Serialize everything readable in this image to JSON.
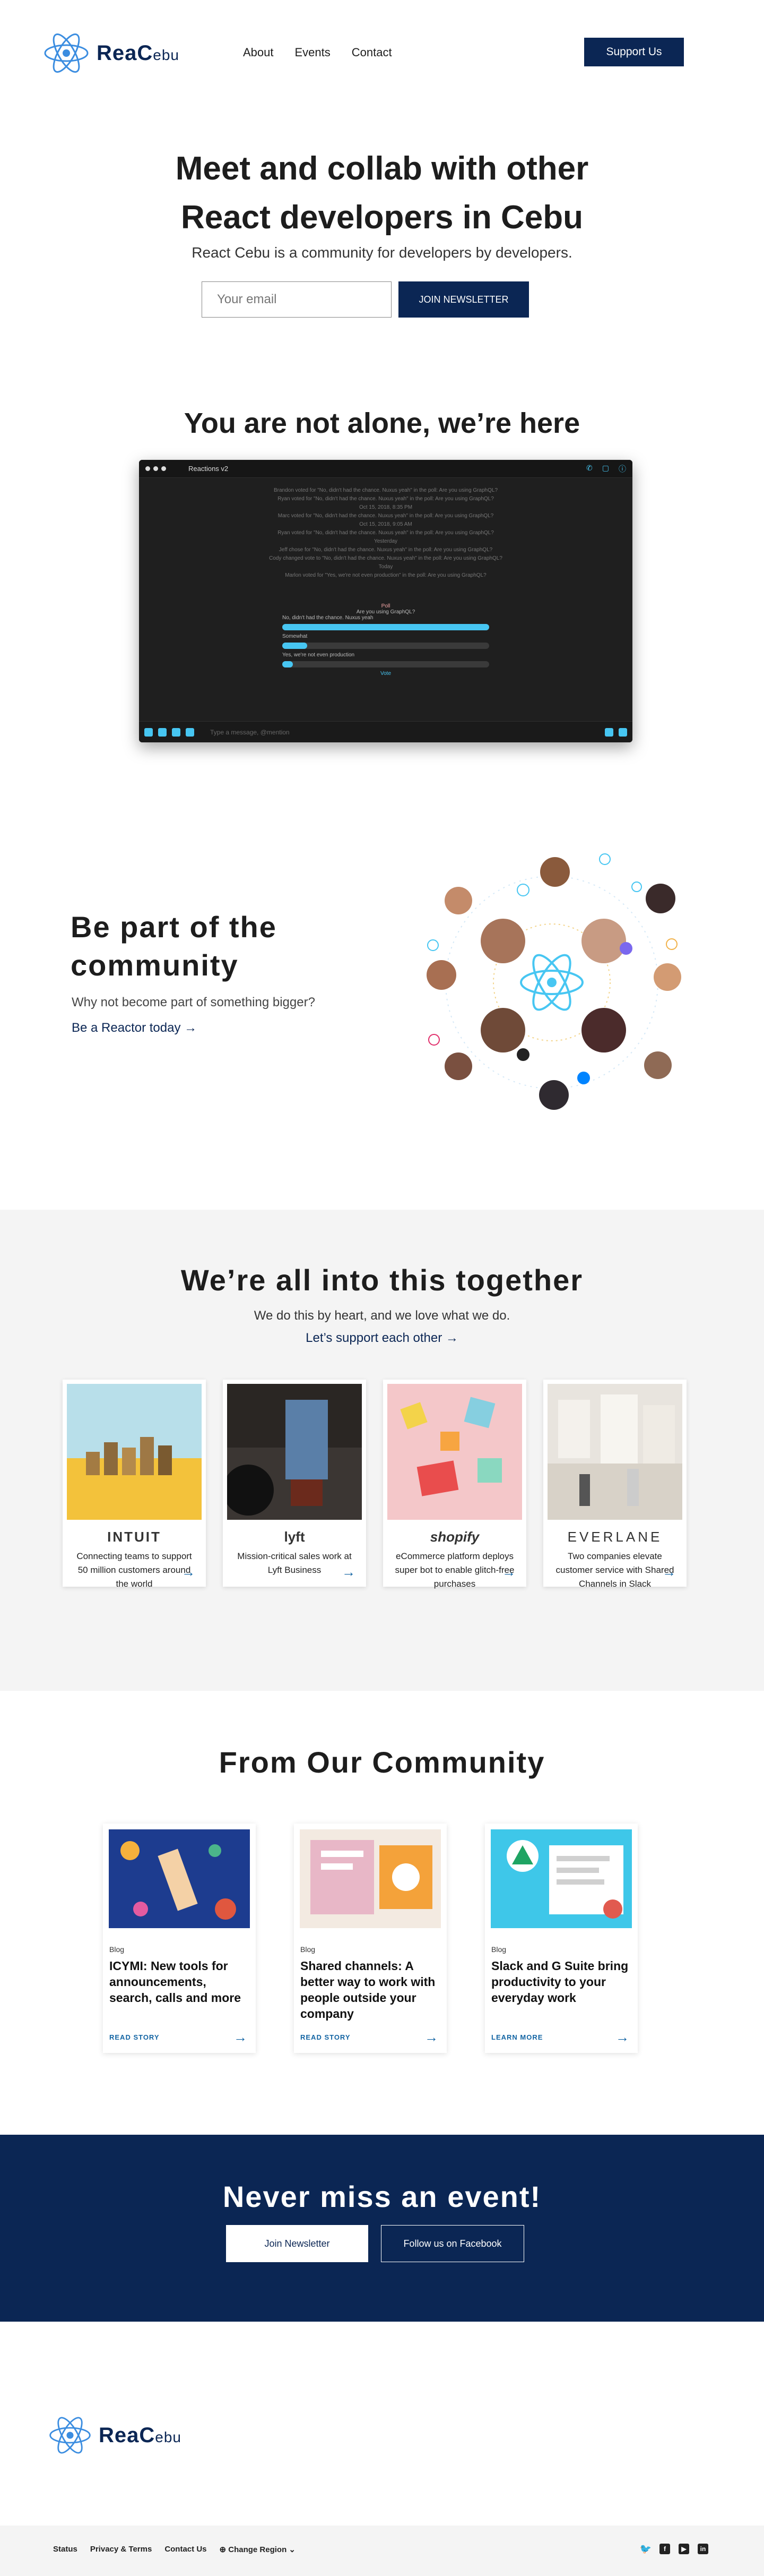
{
  "header": {
    "logo_main": "ReaC",
    "logo_suffix": "ebu",
    "nav": [
      "About",
      "Events",
      "Contact"
    ],
    "support_label": "Support Us"
  },
  "hero": {
    "title_line1": "Meet and collab with other",
    "title_line2": "React developers in Cebu",
    "subtitle": "React Cebu is a community for developers by developers.",
    "email_placeholder": "Your email",
    "join_label": "JOIN NEWSLETTER"
  },
  "alone": {
    "title": "You are not alone, we’re here",
    "chat": {
      "channel": "Reactions v2",
      "lines": [
        "Brandon voted for \"No, didn't had the chance. Nuxus yeah\" in the poll: Are you using GraphQL?",
        "Ryan voted for \"No, didn't had the chance. Nuxus yeah\" in the poll: Are you using GraphQL?",
        "Oct 15, 2018, 8:35 PM",
        "Marc voted for \"No, didn't had the chance. Nuxus yeah\" in the poll: Are you using GraphQL?",
        "Oct 15, 2018, 9:05 AM",
        "Ryan voted for \"No, didn't had the chance. Nuxus yeah\" in the poll: Are you using GraphQL?",
        "Yesterday",
        "Jeff chose for \"No, didn't had the chance. Nuxus yeah\" in the poll: Are you using GraphQL?",
        "Cody changed vote to \"No, didn't had the chance. Nuxus yeah\" in the poll: Are you using GraphQL?",
        "Today",
        "Marlon voted for \"Yes, we're not even production\" in the poll: Are you using GraphQL?"
      ],
      "poll_author": "Poll",
      "poll_question": "Are you using GraphQL?",
      "poll_options": [
        {
          "label": "No, didn't had the chance. Nuxus yeah",
          "fraction": 1.0
        },
        {
          "label": "Somewhat",
          "fraction": 0.12
        },
        {
          "label": "Yes, we're not even production",
          "fraction": 0.05
        }
      ],
      "poll_vote": "Vote",
      "input_placeholder": "Type a message, @mention"
    }
  },
  "community": {
    "title_line1": "Be part of the",
    "title_line2": "community",
    "subtitle": "Why not become part of something bigger?",
    "link": "Be a Reactor today →"
  },
  "together": {
    "title": "We’re all into this together",
    "subtitle": "We do this by heart, and we love what we do.",
    "link": "Let’s support each other →",
    "cards": [
      {
        "logo": "INTUIT",
        "text": "Connecting teams to support 50 million customers around the world"
      },
      {
        "logo": "lyft",
        "text": "Mission-critical sales work at Lyft Business"
      },
      {
        "logo": "shopify",
        "text": "eCommerce platform deploys super bot to enable glitch-free purchases"
      },
      {
        "logo": "EVERLANE",
        "text": "Two companies elevate customer service with Shared Channels in Slack"
      }
    ]
  },
  "from_community": {
    "title": "From Our Community",
    "posts": [
      {
        "tag": "Blog",
        "title": "ICYMI: New tools for announcements, search, calls and more",
        "more": "READ STORY"
      },
      {
        "tag": "Blog",
        "title": "Shared channels: A better way to work with people outside your company",
        "more": "READ STORY"
      },
      {
        "tag": "Blog",
        "title": "Slack and G Suite bring productivity to your everyday work",
        "more": "LEARN MORE"
      }
    ]
  },
  "never_miss": {
    "title": "Never miss an event!",
    "newsletter_label": "Join Newsletter",
    "facebook_label": "Follow us on Facebook"
  },
  "footer": {
    "links": [
      "Status",
      "Privacy & Terms",
      "Contact Us",
      "⊕ Change Region ⌄"
    ],
    "social": [
      "twitter-icon",
      "facebook-icon",
      "youtube-icon",
      "linkedin-icon"
    ]
  },
  "colors": {
    "navy": "#0b2654",
    "react_blue": "#47c6f2",
    "link_blue": "#1264a3"
  }
}
